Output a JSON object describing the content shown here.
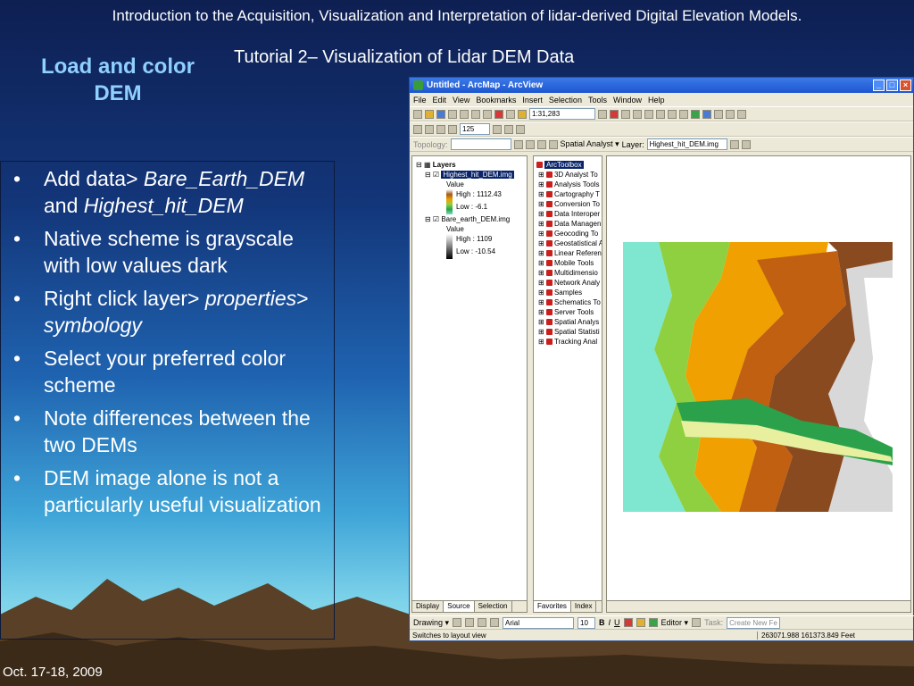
{
  "header": {
    "title": "Introduction to the Acquisition, Visualization and Interpretation of lidar-derived Digital Elevation Models.",
    "subtitle": "Tutorial 2– Visualization of Lidar DEM Data"
  },
  "slide": {
    "title": "Load and color DEM",
    "bullets": {
      "b1_a": "Add data>",
      "b1_b": "Bare_Earth_DEM",
      "b1_c": "and",
      "b1_d": "Highest_hit_DEM",
      "b2": "Native scheme is grayscale with low values dark",
      "b3_a": "Right click layer>",
      "b3_b": "properties",
      "b3_c": ">",
      "b3_d": "symbology",
      "b4": "Select your preferred color scheme",
      "b5": "Note differences between the two DEMs",
      "b6": "DEM image alone is not a particularly useful visualization"
    },
    "footer_date": "Oct. 17-18, 2009"
  },
  "window": {
    "title": "Untitled - ArcMap - ArcView",
    "menu": [
      "File",
      "Edit",
      "View",
      "Bookmarks",
      "Insert",
      "Selection",
      "Tools",
      "Window",
      "Help"
    ],
    "scale": "1:31,283",
    "zoom": "125",
    "topology_label": "Topology:",
    "spatial_analyst_label": "Spatial Analyst ▾",
    "layer_label": "Layer:",
    "layer_value": "Highest_hit_DEM.img",
    "toc": {
      "root": "Layers",
      "layer1": "Highest_hit_DEM.img",
      "layer1_value": "Value",
      "layer1_high": "High : 1112.43",
      "layer1_low": "Low : -6.1",
      "layer2": "Bare_earth_DEM.img",
      "layer2_value": "Value",
      "layer2_high": "High : 1109",
      "layer2_low": "Low : -10.54",
      "tabs": [
        "Display",
        "Source",
        "Selection"
      ]
    },
    "toolbox": {
      "root": "ArcToolbox",
      "items": [
        "3D Analyst To",
        "Analysis Tools",
        "Cartography T",
        "Conversion To",
        "Data Interoper",
        "Data Managen",
        "Geocoding To",
        "Geostatistical A",
        "Linear Referen",
        "Mobile Tools",
        "Multidimensio",
        "Network Analy",
        "Samples",
        "Schematics To",
        "Server Tools",
        "Spatial Analys",
        "Spatial Statisti",
        "Tracking Anal"
      ],
      "tabs": [
        "Favorites",
        "Index"
      ]
    },
    "bottom": {
      "drawing": "Drawing ▾",
      "font": "Arial",
      "size": "10",
      "editor": "Editor ▾",
      "task": "Task:",
      "task_value": "Create New Fe"
    },
    "status": {
      "message": "Switches to layout view",
      "coords": "263071.988  161373.849 Feet"
    }
  }
}
